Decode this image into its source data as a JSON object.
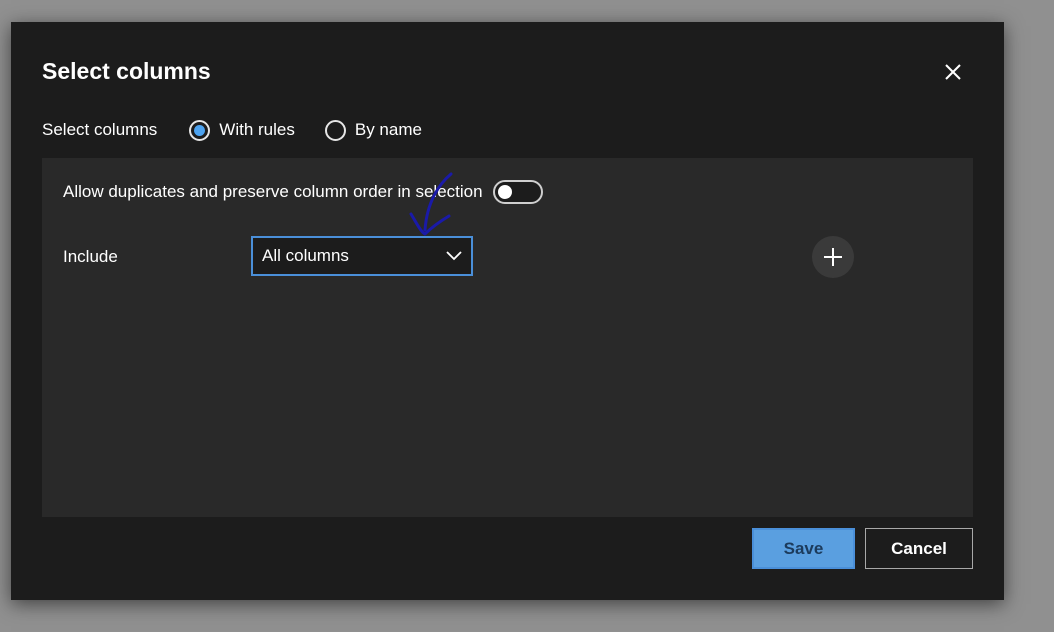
{
  "dialog": {
    "title": "Select columns",
    "close_icon": "close-icon"
  },
  "mode": {
    "label": "Select columns",
    "options": [
      {
        "label": "With rules",
        "selected": true
      },
      {
        "label": "By name",
        "selected": false
      }
    ]
  },
  "rules": {
    "duplicates_label": "Allow duplicates and preserve column order in selection",
    "duplicates_enabled": false,
    "include_label": "Include",
    "include_value": "All columns",
    "add_icon": "plus-icon"
  },
  "footer": {
    "save_label": "Save",
    "cancel_label": "Cancel"
  },
  "colors": {
    "accent": "#4da3f0",
    "dialog_bg": "#1c1c1c",
    "panel_bg": "#292929",
    "annotation": "#1a1aa8"
  }
}
